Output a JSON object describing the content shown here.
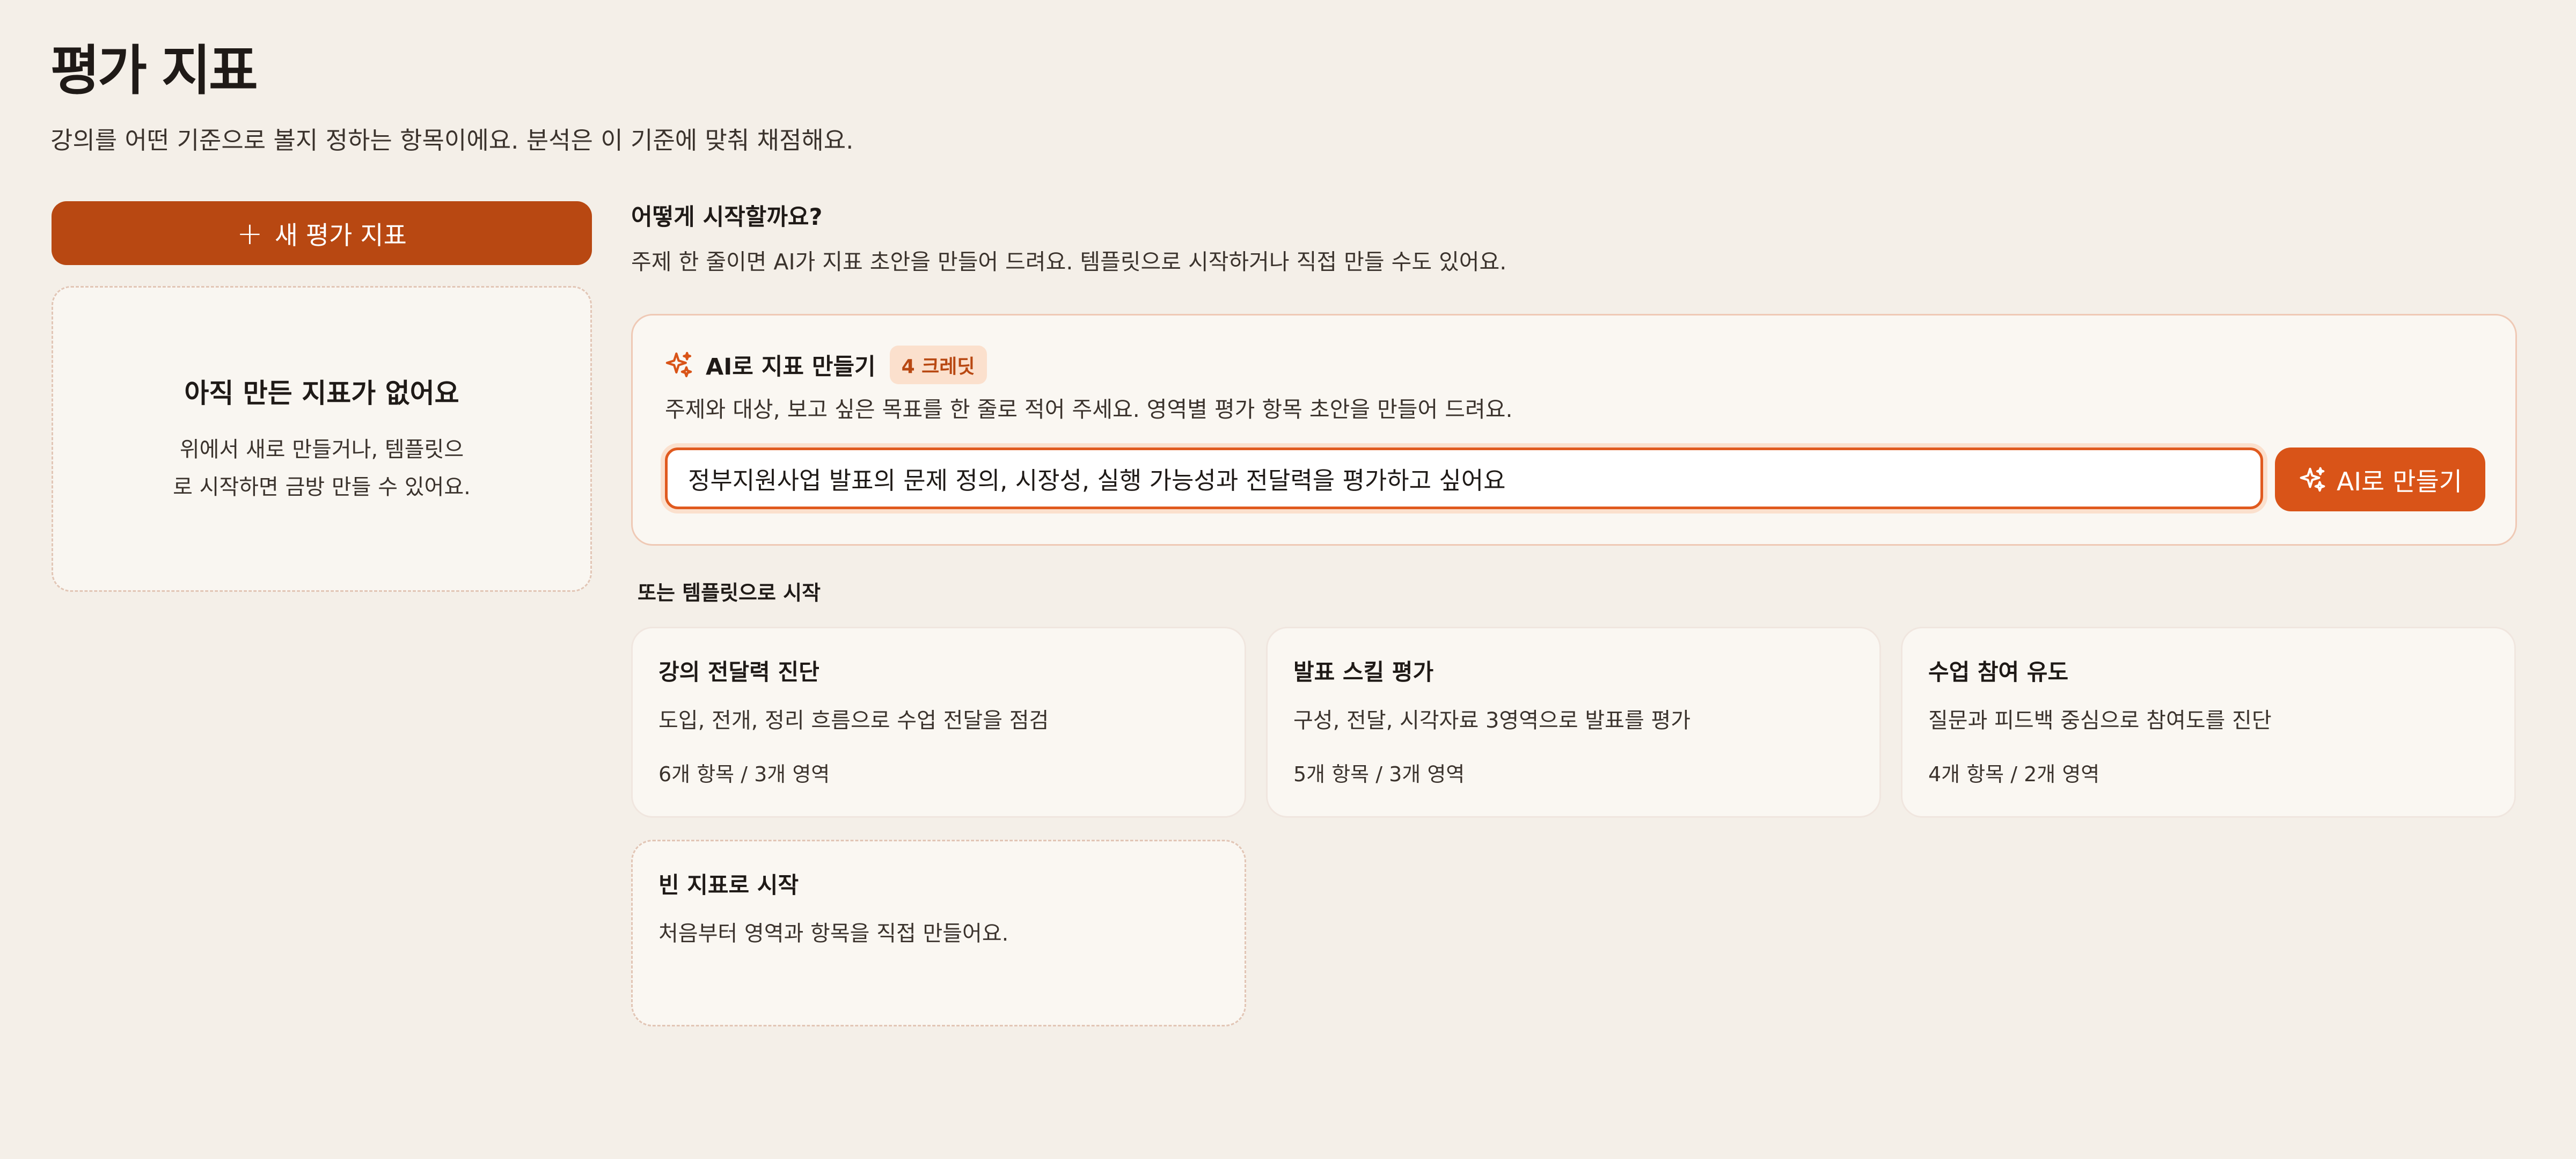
{
  "header": {
    "title": "평가 지표",
    "subtitle": "강의를 어떤 기준으로 볼지 정하는 항목이에요. 분석은 이 기준에 맞춰 채점해요."
  },
  "sidebar": {
    "new_button_icon": "plus-icon",
    "new_button_label": "새 평가 지표",
    "empty": {
      "title": "아직 만든 지표가 없어요",
      "description": "위에서 새로 만들거나, 템플릿으로 시작하면 금방 만들 수 있어요."
    }
  },
  "start": {
    "title": "어떻게 시작할까요?",
    "description": "주제 한 줄이면 AI가 지표 초안을 만들어 드려요. 템플릿으로 시작하거나 직접 만들 수도 있어요."
  },
  "ai": {
    "icon": "sparkle-icon",
    "title": "AI로 지표 만들기",
    "credit": "4 크레딧",
    "description": "주제와 대상, 보고 싶은 목표를 한 줄로 적어 주세요. 영역별 평가 항목 초안을 만들어 드려요.",
    "input_value": "정부지원사업 발표의 문제 정의, 시장성, 실행 가능성과 전달력을 평가하고 싶어요",
    "button_label": "AI로 만들기"
  },
  "templates": {
    "label": "또는 템플릿으로 시작",
    "items": [
      {
        "title": "강의 전달력 진단",
        "description": "도입, 전개, 정리 흐름으로 수업 전달을 점검",
        "meta": "6개 항목 / 3개 영역"
      },
      {
        "title": "발표 스킬 평가",
        "description": "구성, 전달, 시각자료 3영역으로 발표를 평가",
        "meta": "5개 항목 / 3개 영역"
      },
      {
        "title": "수업 참여 유도",
        "description": "질문과 피드백 중심으로 참여도를 진단",
        "meta": "4개 항목 / 2개 영역"
      }
    ],
    "blank": {
      "title": "빈 지표로 시작",
      "description": "처음부터 영역과 항목을 직접 만들어요."
    }
  },
  "colors": {
    "accent": "#b84812",
    "accent_bright": "#d95418",
    "background": "#f4efe8"
  }
}
